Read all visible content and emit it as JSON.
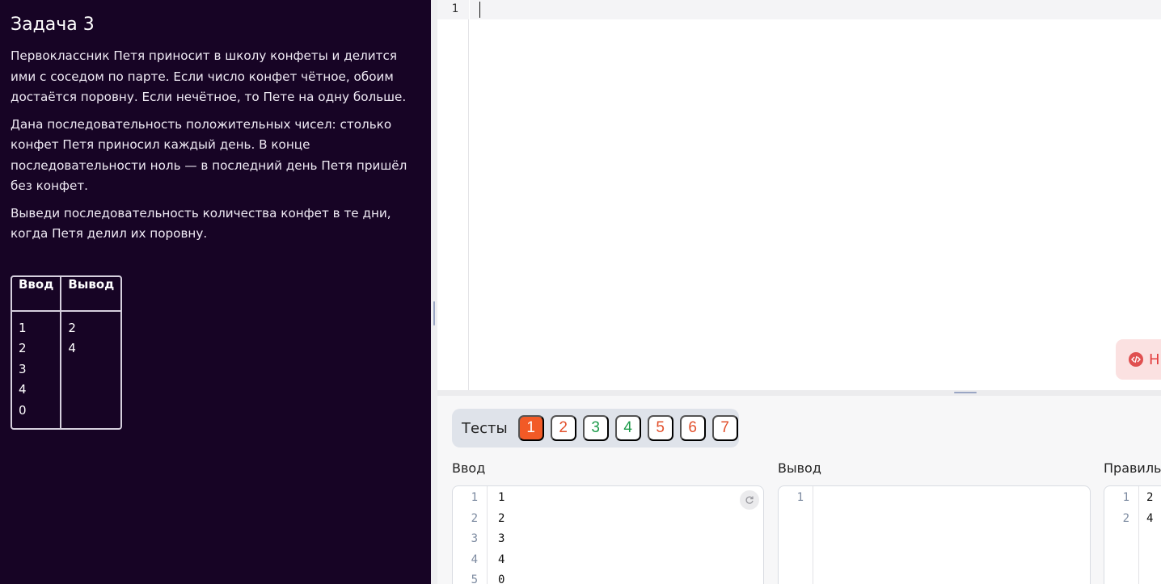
{
  "task": {
    "title": "Задача 3",
    "paragraphs": [
      "Первоклассник Петя приносит в школу конфеты и делится ими с соседом по парте. Если число конфет чётное, обоим достаётся поровну. Если нечётное, то Пете на одну больше.",
      "Дана последовательность положительных чисел: столько конфет Петя приносил каждый день. В конце последовательности ноль — в последний день Петя пришёл без конфет.",
      "Выведи последовательность количества конфет в те дни, когда Петя делил их поровну."
    ],
    "example": {
      "headers": [
        "Ввод",
        "Вывод"
      ],
      "input_lines": [
        "1",
        "2",
        "3",
        "4",
        "0"
      ],
      "output_lines": [
        "2",
        "4"
      ]
    }
  },
  "editor": {
    "line_numbers": [
      "1"
    ],
    "run_button_label": "Н"
  },
  "tests": {
    "label": "Тесты",
    "items": [
      {
        "label": "1",
        "status": "active"
      },
      {
        "label": "2",
        "status": "failed"
      },
      {
        "label": "3",
        "status": "passed"
      },
      {
        "label": "4",
        "status": "passed"
      },
      {
        "label": "5",
        "status": "failed"
      },
      {
        "label": "6",
        "status": "failed"
      },
      {
        "label": "7",
        "status": "failed"
      }
    ]
  },
  "io": {
    "input_label": "Ввод",
    "output_label": "Вывод",
    "expected_label": "Правиль",
    "input_lines": [
      "1",
      "2",
      "3",
      "4",
      "0"
    ],
    "input_line_numbers": [
      "1",
      "2",
      "3",
      "4",
      "5"
    ],
    "output_line_numbers": [
      "1"
    ],
    "expected_lines": [
      "2",
      "4"
    ],
    "expected_line_numbers": [
      "1",
      "2"
    ]
  },
  "colors": {
    "panel_bg": "#170425",
    "active_test": "#f25a26",
    "failed_test": "#e2502c",
    "passed_test": "#1d9b4a"
  }
}
